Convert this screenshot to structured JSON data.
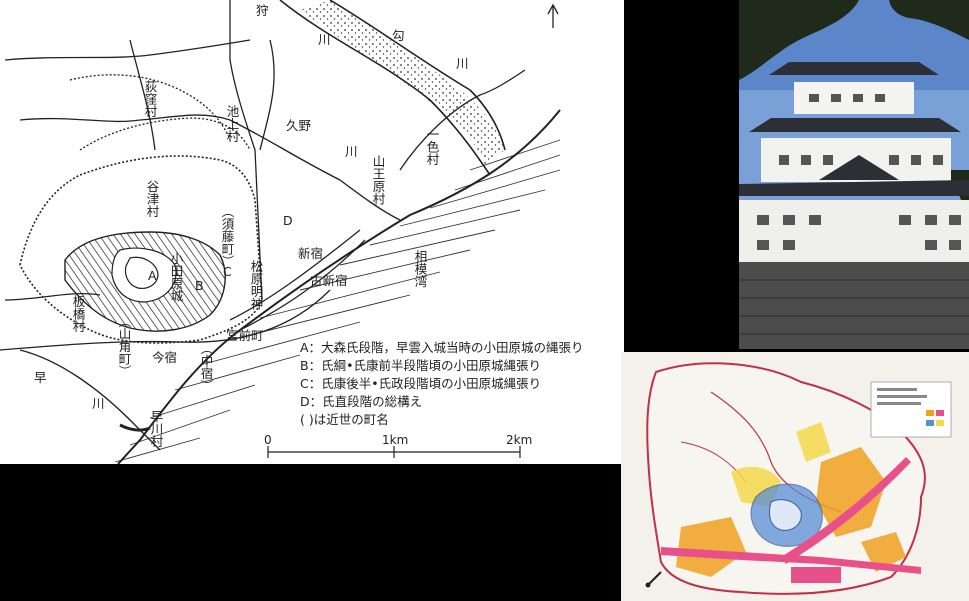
{
  "map": {
    "place_labels": {
      "kari": "狩",
      "ogikubo": "荻窪村",
      "ikegami": "池上村",
      "kuno": "久野",
      "kawa_kuno": "川",
      "sanno": "山王原村",
      "isshiki": "一色村",
      "kou": "勾",
      "kawa_kari": "川",
      "kawa_kou": "川",
      "yatsu": "谷津村",
      "suto": "（須藤町）",
      "matsubara": "松原明神",
      "odawara": "小田原城",
      "itabashi": "板橋村",
      "yamakado": "（山角町）",
      "imajuku": "今宿",
      "nakajuku": "（中宿）",
      "miyamae": "宮前町",
      "shinjuku": "新宿",
      "koshinjuku": "古新宿",
      "sagami": "相模湾",
      "haya": "早",
      "kawa_haya": "川",
      "hayakawa": "早川村",
      "mark_a": "A",
      "mark_b": "B",
      "mark_c": "C",
      "mark_d": "D"
    },
    "legend": [
      "A：大森氏段階，早雲入城当時の小田原城の縄張り",
      "B：氏綱•氏康前半段階頃の小田原城縄張り",
      "C：氏康後半•氏政段階頃の小田原城縄張り",
      "D：氏直段階の総構え",
      "(  )は近世の町名"
    ],
    "scale": {
      "ticks": [
        "0",
        "1km",
        "2km"
      ]
    }
  },
  "colors": {
    "background": "#000000",
    "sky": "#7aa0d8",
    "plan_orange": "#f0a020",
    "plan_pink": "#e8508a",
    "plan_blue": "#5a8fd6",
    "plan_yellow": "#f5d84a",
    "plan_red_outline": "#c03048"
  }
}
